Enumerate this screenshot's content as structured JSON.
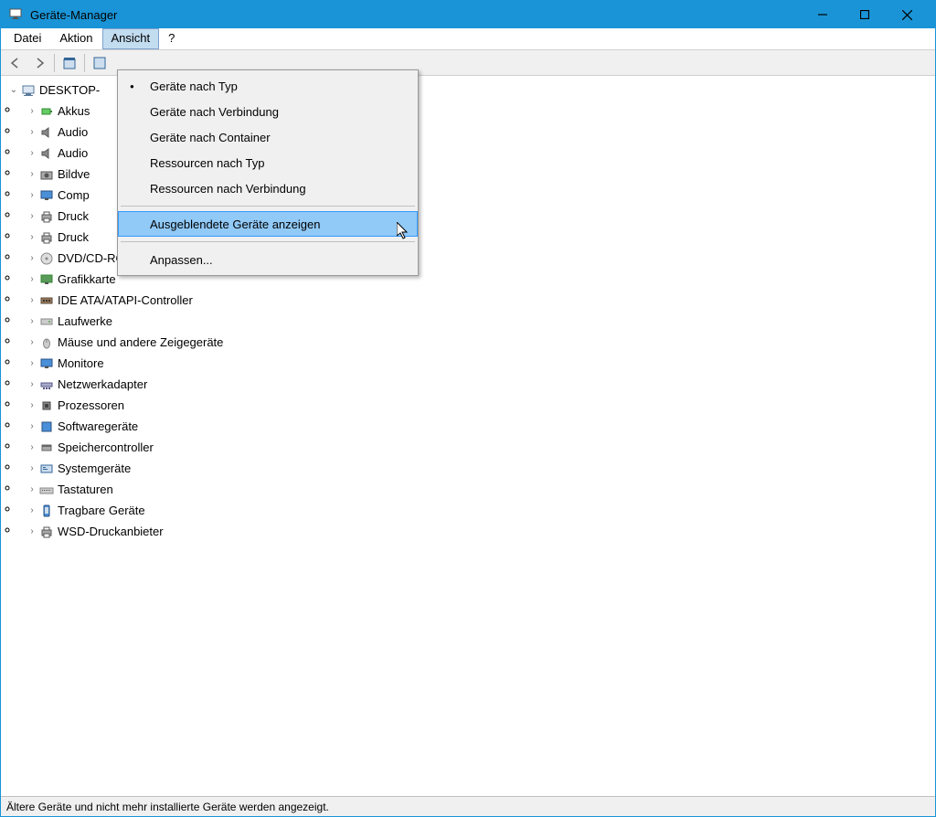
{
  "window": {
    "title": "Geräte-Manager"
  },
  "menubar": {
    "items": [
      "Datei",
      "Aktion",
      "Ansicht",
      "?"
    ],
    "active_index": 2
  },
  "dropdown": {
    "sections": [
      {
        "items": [
          {
            "label": "Geräte nach Typ",
            "checked": true
          },
          {
            "label": "Geräte nach Verbindung"
          },
          {
            "label": "Geräte nach Container"
          },
          {
            "label": "Ressourcen nach Typ"
          },
          {
            "label": "Ressourcen nach Verbindung"
          }
        ]
      },
      {
        "items": [
          {
            "label": "Ausgeblendete Geräte anzeigen",
            "highlighted": true
          }
        ]
      },
      {
        "items": [
          {
            "label": "Anpassen..."
          }
        ]
      }
    ]
  },
  "tree": {
    "root": {
      "label": "DESKTOP-",
      "expanded": true
    },
    "children": [
      {
        "label": "Akkus",
        "icon": "battery"
      },
      {
        "label": "Audio",
        "icon": "speaker"
      },
      {
        "label": "Audio",
        "icon": "speaker"
      },
      {
        "label": "Bildve",
        "icon": "camera"
      },
      {
        "label": "Comp",
        "icon": "monitor"
      },
      {
        "label": "Druck",
        "icon": "printer"
      },
      {
        "label": "Druck",
        "icon": "printer"
      },
      {
        "label": "DVD/CD-ROM-Laufwerke",
        "icon": "disc"
      },
      {
        "label": "Grafikkarte",
        "icon": "display"
      },
      {
        "label": "IDE ATA/ATAPI-Controller",
        "icon": "controller"
      },
      {
        "label": "Laufwerke",
        "icon": "drive"
      },
      {
        "label": "Mäuse und andere Zeigegeräte",
        "icon": "mouse"
      },
      {
        "label": "Monitore",
        "icon": "monitor"
      },
      {
        "label": "Netzwerkadapter",
        "icon": "network"
      },
      {
        "label": "Prozessoren",
        "icon": "cpu"
      },
      {
        "label": "Softwaregeräte",
        "icon": "software"
      },
      {
        "label": "Speichercontroller",
        "icon": "storage"
      },
      {
        "label": "Systemgeräte",
        "icon": "system"
      },
      {
        "label": "Tastaturen",
        "icon": "keyboard"
      },
      {
        "label": "Tragbare Geräte",
        "icon": "portable"
      },
      {
        "label": "WSD-Druckanbieter",
        "icon": "printer"
      }
    ]
  },
  "statusbar": {
    "text": "Ältere Geräte und nicht mehr installierte Geräte werden angezeigt."
  }
}
